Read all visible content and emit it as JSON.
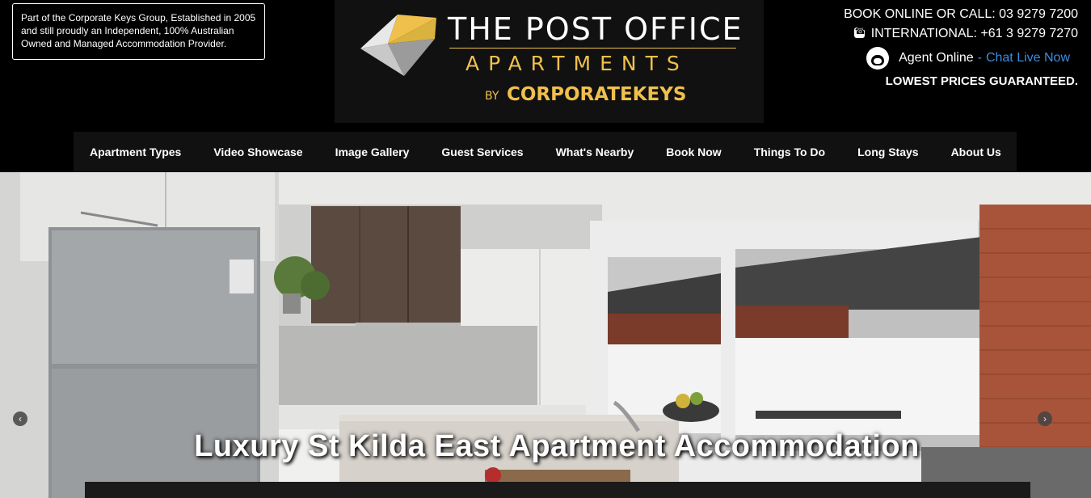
{
  "header": {
    "group_note": "Part of the Corporate Keys Group, Established in 2005 and still proudly an Independent, 100% Australian Owned and Managed Accommodation Provider.",
    "logo": {
      "title": "THE POST OFFICE",
      "subtitle": "APARTMENTS",
      "by": "BY",
      "brand": "CORPORATEKEYS"
    },
    "contact": {
      "book_line": "BOOK ONLINE OR CALL: 03 9279 7200",
      "international_line": "INTERNATIONAL: +61 3 9279 7270",
      "agent_label": "Agent Online",
      "separator": "-",
      "chat_link": "Chat Live Now",
      "guarantee": "LOWEST PRICES GUARANTEED."
    }
  },
  "nav": {
    "items": [
      {
        "label": "Apartment Types"
      },
      {
        "label": "Video Showcase"
      },
      {
        "label": "Image Gallery"
      },
      {
        "label": "Guest Services"
      },
      {
        "label": "What's Nearby"
      },
      {
        "label": "Book Now"
      },
      {
        "label": "Things To Do"
      },
      {
        "label": "Long Stays"
      },
      {
        "label": "About Us"
      }
    ]
  },
  "hero": {
    "caption": "Luxury St Kilda East Apartment Accommodation",
    "prev_arrow": "‹",
    "next_arrow": "›"
  },
  "colors": {
    "accent_gold": "#f0c04c",
    "link_blue": "#3b8de0",
    "nav_bg": "#111111"
  }
}
